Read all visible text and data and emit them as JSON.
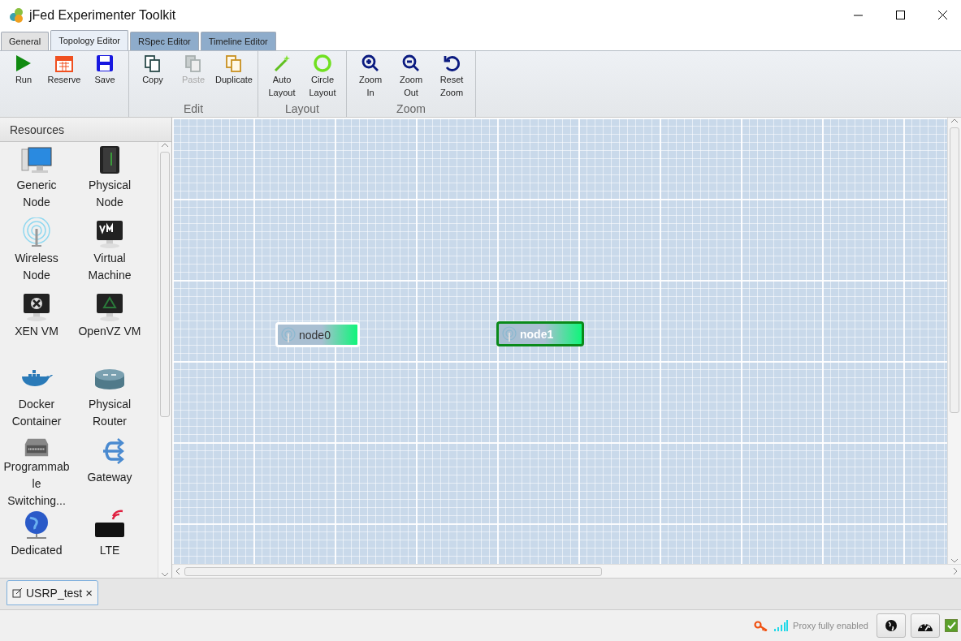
{
  "window": {
    "title": "jFed Experimenter Toolkit"
  },
  "tabs": [
    {
      "label": "General",
      "selected": false,
      "color": "#e2e2e2"
    },
    {
      "label": "Topology Editor",
      "selected": true,
      "color": "#e9eff7"
    },
    {
      "label": "RSpec Editor",
      "selected": false,
      "color": "#8eaccb"
    },
    {
      "label": "Timeline Editor",
      "selected": false,
      "color": "#8eaccb"
    }
  ],
  "ribbon": [
    {
      "buttons": [
        {
          "label": "Run",
          "disabled": false
        },
        {
          "label": "Reserve",
          "disabled": false
        },
        {
          "label": "Save",
          "disabled": false
        }
      ]
    },
    {
      "label": "Edit",
      "buttons": [
        {
          "label": "Copy",
          "disabled": false
        },
        {
          "label": "Paste",
          "disabled": true
        },
        {
          "label": "Duplicate",
          "disabled": false
        }
      ]
    },
    {
      "label": "Layout",
      "buttons": [
        {
          "label": "Auto Layout",
          "disabled": false
        },
        {
          "label": "Circle Layout",
          "disabled": false
        }
      ]
    },
    {
      "label": "Zoom",
      "buttons": [
        {
          "label": "Zoom In",
          "disabled": false
        },
        {
          "label": "Zoom Out",
          "disabled": false
        },
        {
          "label": "Reset Zoom",
          "disabled": false
        }
      ]
    }
  ],
  "resources": {
    "title": "Resources",
    "items": [
      {
        "label": "Generic Node"
      },
      {
        "label": "Physical Node"
      },
      {
        "label": "Wireless Node"
      },
      {
        "label": "Virtual Machine"
      },
      {
        "label": "XEN VM"
      },
      {
        "label": "OpenVZ VM"
      },
      {
        "label": "Docker Container"
      },
      {
        "label": "Physical Router"
      },
      {
        "label": "Programmab le Switching..."
      },
      {
        "label": "Gateway"
      },
      {
        "label": "Dedicated"
      },
      {
        "label": "LTE"
      }
    ]
  },
  "canvas": {
    "nodes": [
      {
        "label": "node0",
        "selected": false
      },
      {
        "label": "node1",
        "selected": true
      }
    ]
  },
  "documents": [
    {
      "label": "USRP_test",
      "close": "×"
    }
  ],
  "status_bar": {
    "proxy": "Proxy fully enabled",
    "checked": true
  }
}
